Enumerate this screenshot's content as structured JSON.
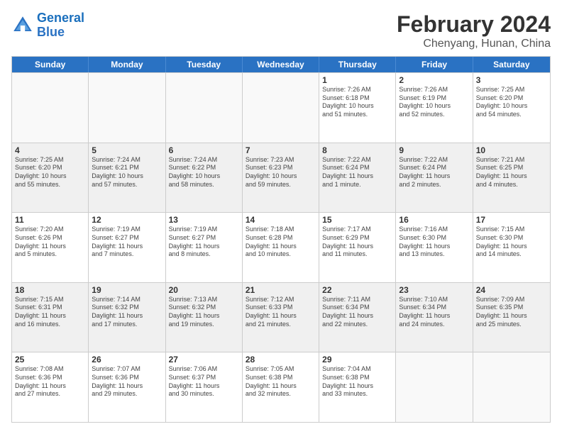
{
  "header": {
    "logo_general": "General",
    "logo_blue": "Blue",
    "month_year": "February 2024",
    "location": "Chenyang, Hunan, China"
  },
  "weekdays": [
    "Sunday",
    "Monday",
    "Tuesday",
    "Wednesday",
    "Thursday",
    "Friday",
    "Saturday"
  ],
  "rows": [
    [
      {
        "day": "",
        "info": "",
        "empty": true
      },
      {
        "day": "",
        "info": "",
        "empty": true
      },
      {
        "day": "",
        "info": "",
        "empty": true
      },
      {
        "day": "",
        "info": "",
        "empty": true
      },
      {
        "day": "1",
        "info": "Sunrise: 7:26 AM\nSunset: 6:18 PM\nDaylight: 10 hours\nand 51 minutes."
      },
      {
        "day": "2",
        "info": "Sunrise: 7:26 AM\nSunset: 6:19 PM\nDaylight: 10 hours\nand 52 minutes."
      },
      {
        "day": "3",
        "info": "Sunrise: 7:25 AM\nSunset: 6:20 PM\nDaylight: 10 hours\nand 54 minutes."
      }
    ],
    [
      {
        "day": "4",
        "info": "Sunrise: 7:25 AM\nSunset: 6:20 PM\nDaylight: 10 hours\nand 55 minutes."
      },
      {
        "day": "5",
        "info": "Sunrise: 7:24 AM\nSunset: 6:21 PM\nDaylight: 10 hours\nand 57 minutes."
      },
      {
        "day": "6",
        "info": "Sunrise: 7:24 AM\nSunset: 6:22 PM\nDaylight: 10 hours\nand 58 minutes."
      },
      {
        "day": "7",
        "info": "Sunrise: 7:23 AM\nSunset: 6:23 PM\nDaylight: 10 hours\nand 59 minutes."
      },
      {
        "day": "8",
        "info": "Sunrise: 7:22 AM\nSunset: 6:24 PM\nDaylight: 11 hours\nand 1 minute."
      },
      {
        "day": "9",
        "info": "Sunrise: 7:22 AM\nSunset: 6:24 PM\nDaylight: 11 hours\nand 2 minutes."
      },
      {
        "day": "10",
        "info": "Sunrise: 7:21 AM\nSunset: 6:25 PM\nDaylight: 11 hours\nand 4 minutes."
      }
    ],
    [
      {
        "day": "11",
        "info": "Sunrise: 7:20 AM\nSunset: 6:26 PM\nDaylight: 11 hours\nand 5 minutes."
      },
      {
        "day": "12",
        "info": "Sunrise: 7:19 AM\nSunset: 6:27 PM\nDaylight: 11 hours\nand 7 minutes."
      },
      {
        "day": "13",
        "info": "Sunrise: 7:19 AM\nSunset: 6:27 PM\nDaylight: 11 hours\nand 8 minutes."
      },
      {
        "day": "14",
        "info": "Sunrise: 7:18 AM\nSunset: 6:28 PM\nDaylight: 11 hours\nand 10 minutes."
      },
      {
        "day": "15",
        "info": "Sunrise: 7:17 AM\nSunset: 6:29 PM\nDaylight: 11 hours\nand 11 minutes."
      },
      {
        "day": "16",
        "info": "Sunrise: 7:16 AM\nSunset: 6:30 PM\nDaylight: 11 hours\nand 13 minutes."
      },
      {
        "day": "17",
        "info": "Sunrise: 7:15 AM\nSunset: 6:30 PM\nDaylight: 11 hours\nand 14 minutes."
      }
    ],
    [
      {
        "day": "18",
        "info": "Sunrise: 7:15 AM\nSunset: 6:31 PM\nDaylight: 11 hours\nand 16 minutes."
      },
      {
        "day": "19",
        "info": "Sunrise: 7:14 AM\nSunset: 6:32 PM\nDaylight: 11 hours\nand 17 minutes."
      },
      {
        "day": "20",
        "info": "Sunrise: 7:13 AM\nSunset: 6:32 PM\nDaylight: 11 hours\nand 19 minutes."
      },
      {
        "day": "21",
        "info": "Sunrise: 7:12 AM\nSunset: 6:33 PM\nDaylight: 11 hours\nand 21 minutes."
      },
      {
        "day": "22",
        "info": "Sunrise: 7:11 AM\nSunset: 6:34 PM\nDaylight: 11 hours\nand 22 minutes."
      },
      {
        "day": "23",
        "info": "Sunrise: 7:10 AM\nSunset: 6:34 PM\nDaylight: 11 hours\nand 24 minutes."
      },
      {
        "day": "24",
        "info": "Sunrise: 7:09 AM\nSunset: 6:35 PM\nDaylight: 11 hours\nand 25 minutes."
      }
    ],
    [
      {
        "day": "25",
        "info": "Sunrise: 7:08 AM\nSunset: 6:36 PM\nDaylight: 11 hours\nand 27 minutes."
      },
      {
        "day": "26",
        "info": "Sunrise: 7:07 AM\nSunset: 6:36 PM\nDaylight: 11 hours\nand 29 minutes."
      },
      {
        "day": "27",
        "info": "Sunrise: 7:06 AM\nSunset: 6:37 PM\nDaylight: 11 hours\nand 30 minutes."
      },
      {
        "day": "28",
        "info": "Sunrise: 7:05 AM\nSunset: 6:38 PM\nDaylight: 11 hours\nand 32 minutes."
      },
      {
        "day": "29",
        "info": "Sunrise: 7:04 AM\nSunset: 6:38 PM\nDaylight: 11 hours\nand 33 minutes."
      },
      {
        "day": "",
        "info": "",
        "empty": true
      },
      {
        "day": "",
        "info": "",
        "empty": true
      }
    ]
  ]
}
